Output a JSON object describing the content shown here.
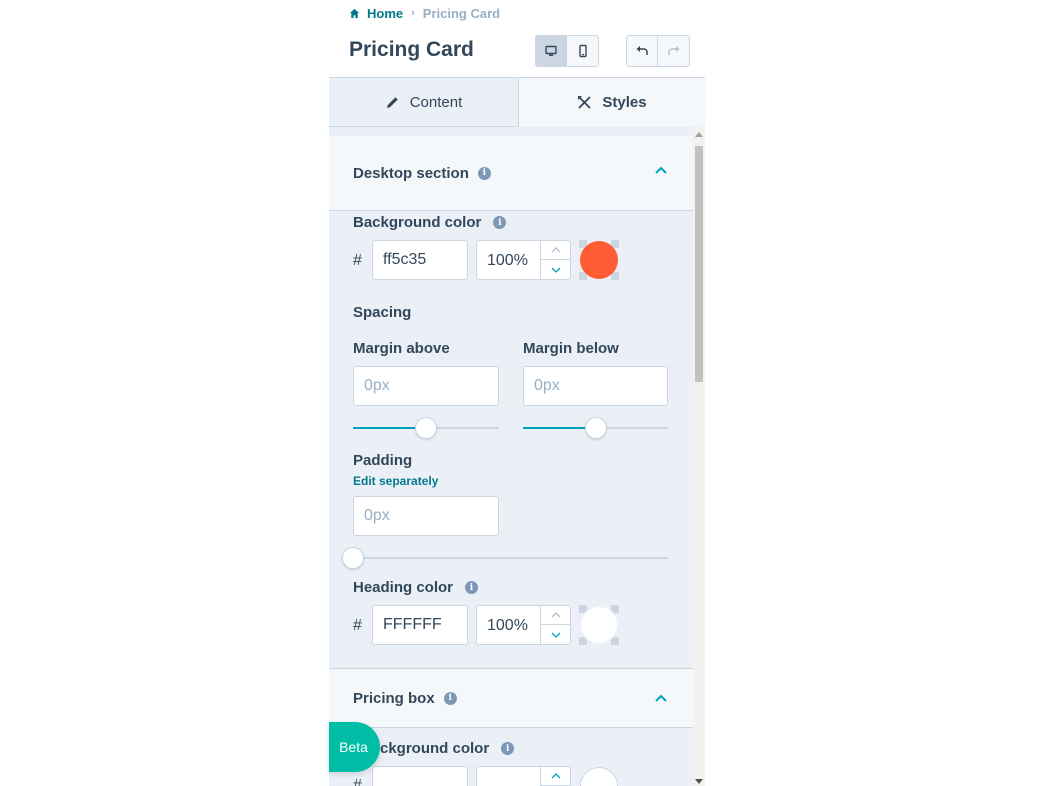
{
  "breadcrumb": {
    "home": "Home",
    "separator": "›",
    "current": "Pricing Card"
  },
  "page": {
    "title": "Pricing Card"
  },
  "tabs": [
    {
      "label": "Content",
      "icon": "pencil-icon"
    },
    {
      "label": "Styles",
      "icon": "styles-icon"
    }
  ],
  "sections": {
    "desktop": {
      "title": "Desktop section",
      "background_color": {
        "label": "Background color",
        "hash": "#",
        "hex": "ff5c35",
        "opacity": "100%",
        "swatch": "#ff5c35"
      },
      "spacing": {
        "label": "Spacing",
        "margin_above": {
          "label": "Margin above",
          "placeholder": "0px",
          "level_percent": 50
        },
        "margin_below": {
          "label": "Margin below",
          "placeholder": "0px",
          "level_percent": 50
        }
      },
      "padding": {
        "label": "Padding",
        "edit_link": "Edit separately",
        "placeholder": "0px",
        "level_percent": 0
      },
      "heading_color": {
        "label": "Heading color",
        "hash": "#",
        "hex": "FFFFFF",
        "opacity": "100%",
        "swatch": "#ffffff"
      }
    },
    "pricing_box": {
      "title": "Pricing box",
      "background_color": {
        "label": "ckground color",
        "hash": "#"
      }
    }
  },
  "beta_label": "Beta",
  "colors": {
    "accent": "#00a4bd",
    "link": "#007a8c",
    "panel_bg": "#eaf0f6",
    "border": "#cbd6e2",
    "beta": "#00bda5"
  }
}
